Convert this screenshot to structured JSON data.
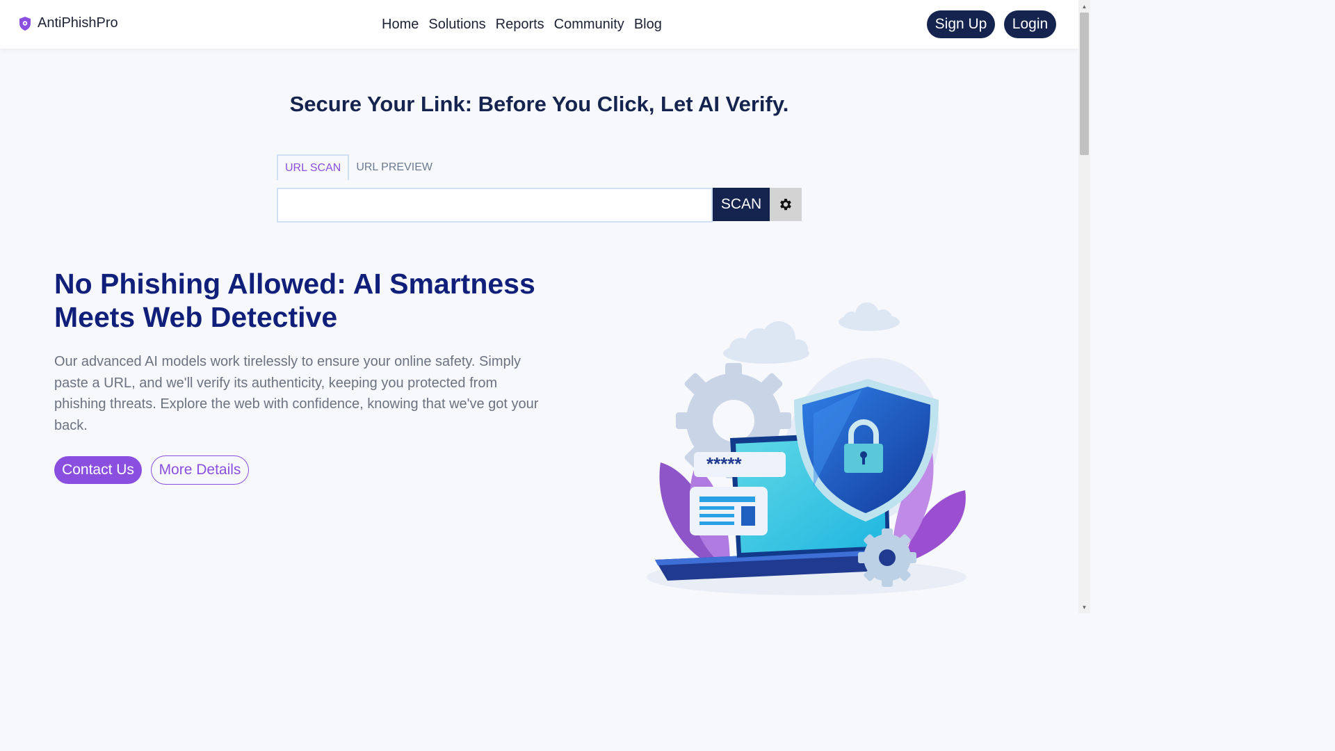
{
  "nav": {
    "brand_name": "AntiPhishPro",
    "links": [
      "Home",
      "Solutions",
      "Reports",
      "Community",
      "Blog"
    ],
    "signup_label": "Sign Up",
    "login_label": "Login"
  },
  "hero": {
    "tagline": "Secure Your Link: Before You Click, Let AI Verify."
  },
  "scanner": {
    "tabs": [
      "URL SCAN",
      "URL PREVIEW"
    ],
    "active_tab": "URL SCAN",
    "input_value": "",
    "scan_label": "SCAN"
  },
  "intro": {
    "headline_line1": "No Phishing Allowed: AI Smartness",
    "headline_line2": "Meets Web Detective",
    "description": "Our advanced AI models work tirelessly to ensure your online safety. Simply paste a URL, and we'll verify its authenticity, keeping you protected from phishing threats. Explore the web with confidence, knowing that we've got your back.",
    "contact_label": "Contact Us",
    "details_label": "More Details"
  },
  "illustration": {
    "password_mask": "*****"
  },
  "colors": {
    "navy": "#14244f",
    "headline": "#0f1f7a",
    "purple": "#8b4fe0",
    "background": "#f7f8fb"
  },
  "icons": {
    "brand": "shield-icon",
    "settings": "gear-icon"
  }
}
